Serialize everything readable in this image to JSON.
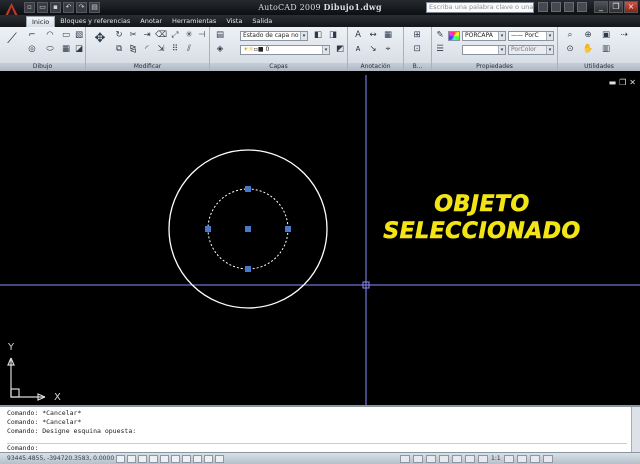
{
  "window": {
    "title_app": "AutoCAD 2009",
    "title_file": "Dibujo1.dwg",
    "search_placeholder": "Escriba una palabra clave o una frase"
  },
  "tabs": [
    "Inicio",
    "Bloques y referencias",
    "Anotar",
    "Herramientas",
    "Vista",
    "Salida"
  ],
  "panels": {
    "dibujo": "Dibujo",
    "modificar": "Modificar",
    "capas": "Capas",
    "anotacion": "Anotación",
    "bloque": "B...",
    "propiedades": "Propiedades",
    "utilidades": "Utilidades"
  },
  "capas": {
    "layer_state": "Estado de capa no g",
    "layer_current": "0"
  },
  "propiedades": {
    "color": "PORCAPA",
    "linetype": "PorC",
    "lineweight": "PorColor"
  },
  "annotation": {
    "line1": "OBJETO",
    "line2": "SELECCIONADO"
  },
  "ucs": {
    "x_label": "X",
    "y_label": "Y"
  },
  "command_history": [
    "Comando: *Cancelar*",
    "Comando: *Cancelar*",
    "Comando: Designe esquina opuesta:"
  ],
  "command_prompt": "Comando:",
  "status": {
    "coordinates": "93445.4855, -394720.3583, 0.0000",
    "annotation_scale": "1:1"
  },
  "colors": {
    "canvas_bg": "#000000",
    "crosshair": "#8c8cff",
    "grip": "#4a78c8",
    "annotation": "#f2e415",
    "circle": "#ffffff"
  },
  "icons": {
    "app_logo": "autocad-logo-icon",
    "grip": "grip-square-icon",
    "ucs": "ucs-icon"
  }
}
